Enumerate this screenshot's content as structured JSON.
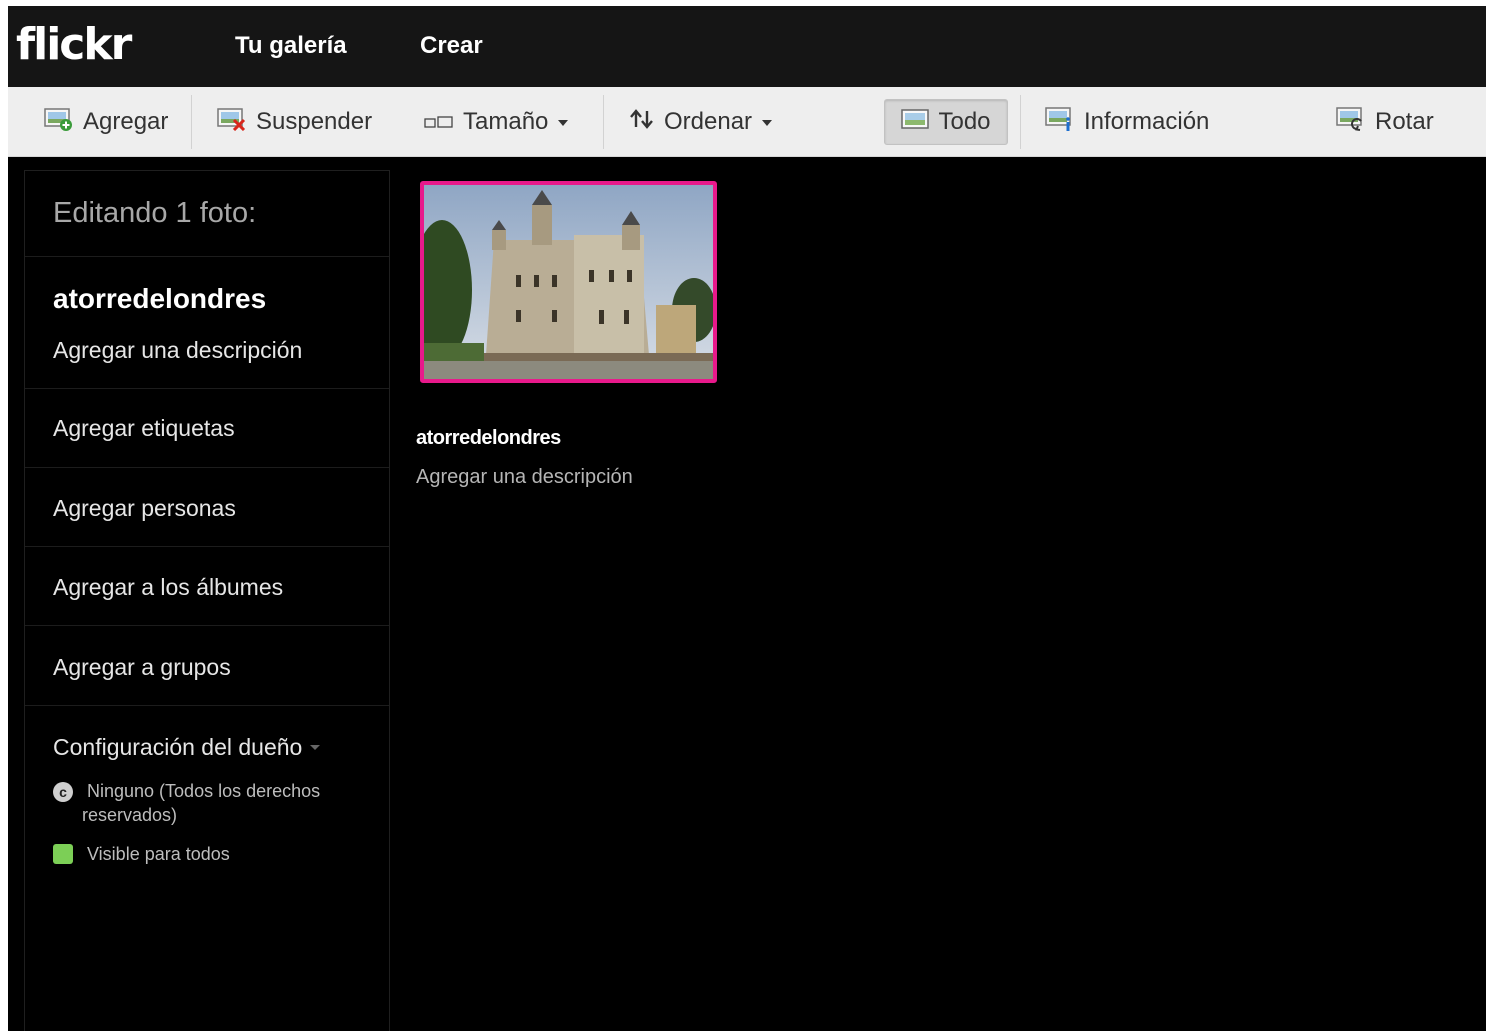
{
  "nav": {
    "logo": "flickr",
    "gallery": "Tu galería",
    "create": "Crear"
  },
  "toolbar": {
    "add": "Agregar",
    "suspend": "Suspender",
    "size": "Tamaño",
    "sort": "Ordenar",
    "all": "Todo",
    "info": "Información",
    "rotate": "Rotar"
  },
  "sidebar": {
    "heading": "Editando 1 foto:",
    "title": "atorredelondres",
    "description": "Agregar una descripción",
    "tags": "Agregar etiquetas",
    "people": "Agregar personas",
    "albums": "Agregar a los álbumes",
    "groups": "Agregar a grupos",
    "owner_settings": "Configuración del dueño",
    "license_line1": "Ninguno (Todos los derechos",
    "license_line2": "reservados)",
    "visibility": "Visible para todos"
  },
  "photo": {
    "title": "atorredelondres",
    "description": "Agregar una descripción",
    "frame_color": "#e8198b"
  },
  "colors": {
    "visible_badge": "#7ccf56"
  }
}
